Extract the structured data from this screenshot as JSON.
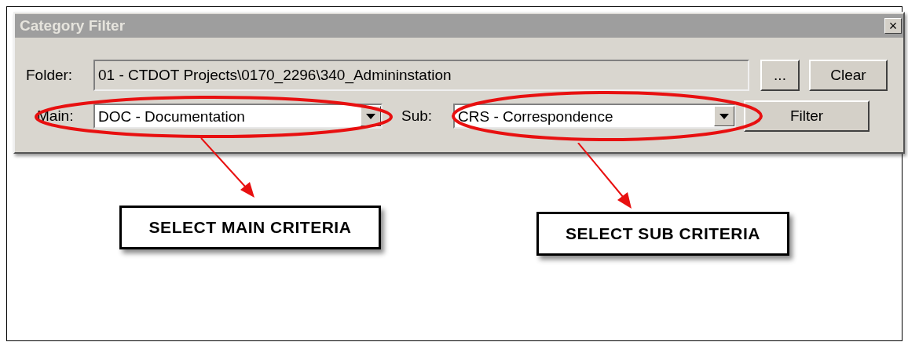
{
  "window": {
    "title": "Category Filter",
    "close": "×"
  },
  "folder": {
    "label": "Folder:",
    "value": "01 - CTDOT Projects\\0170_2296\\340_Admininstation"
  },
  "browse_button": "...",
  "clear_button": "Clear",
  "main": {
    "label": "Main:",
    "value": "DOC - Documentation"
  },
  "sub": {
    "label": "Sub:",
    "value": "CRS - Correspondence"
  },
  "filter_button": "Filter",
  "callouts": [
    {
      "text": "SELECT MAIN CRITERIA"
    },
    {
      "text": "SELECT SUB CRITERIA"
    }
  ]
}
